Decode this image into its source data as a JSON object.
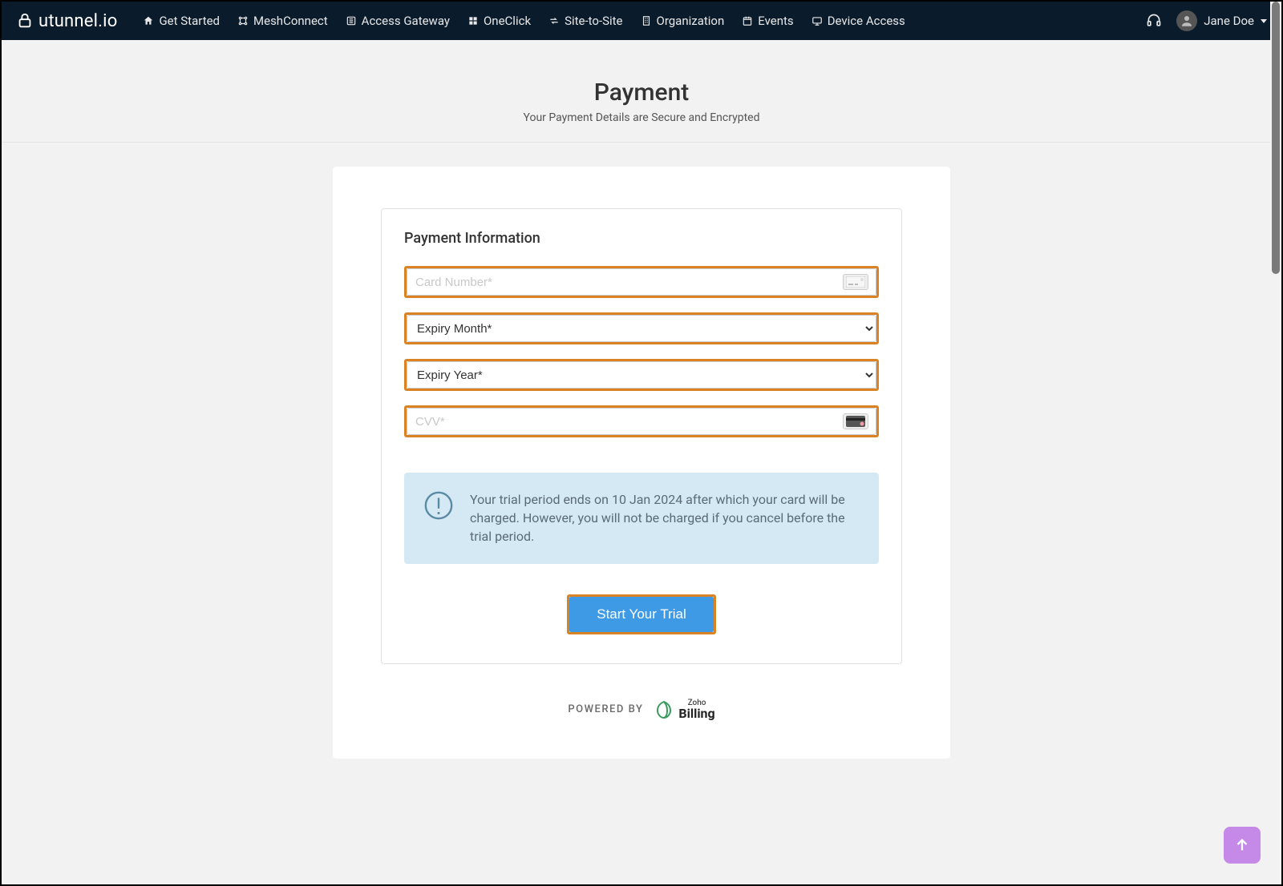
{
  "brand": {
    "name": "utunnel.io"
  },
  "nav": {
    "items": [
      {
        "label": "Get Started",
        "icon": "home-icon"
      },
      {
        "label": "MeshConnect",
        "icon": "mesh-icon"
      },
      {
        "label": "Access Gateway",
        "icon": "gateway-icon"
      },
      {
        "label": "OneClick",
        "icon": "oneclick-icon"
      },
      {
        "label": "Site-to-Site",
        "icon": "sitetosite-icon"
      },
      {
        "label": "Organization",
        "icon": "organization-icon"
      },
      {
        "label": "Events",
        "icon": "events-icon"
      },
      {
        "label": "Device Access",
        "icon": "device-access-icon"
      }
    ],
    "support_icon": "headset-icon",
    "user": {
      "name": "Jane Doe"
    }
  },
  "page": {
    "title": "Payment",
    "subtitle": "Your Payment Details are Secure and Encrypted"
  },
  "form": {
    "section_title": "Payment Information",
    "card_number": {
      "placeholder": "Card Number*",
      "value": ""
    },
    "expiry_month": {
      "selected": "Expiry Month*"
    },
    "expiry_year": {
      "selected": "Expiry Year*"
    },
    "cvv": {
      "placeholder": "CVV*",
      "value": ""
    }
  },
  "banner": {
    "text": "Your trial period ends on 10 Jan 2024 after which your card will be charged. However, you will not be charged if you cancel before the trial period."
  },
  "cta": {
    "label": "Start Your Trial"
  },
  "footer": {
    "powered_by": "POWERED BY",
    "zoho_small": "Zoho",
    "zoho_big": "Billing"
  },
  "colors": {
    "highlight_border": "#d98324",
    "primary_button": "#3f9ae5",
    "banner_bg": "#d4e9f4",
    "fab_bg": "#c58ae8",
    "navbar_bg": "#0a1b2b"
  }
}
